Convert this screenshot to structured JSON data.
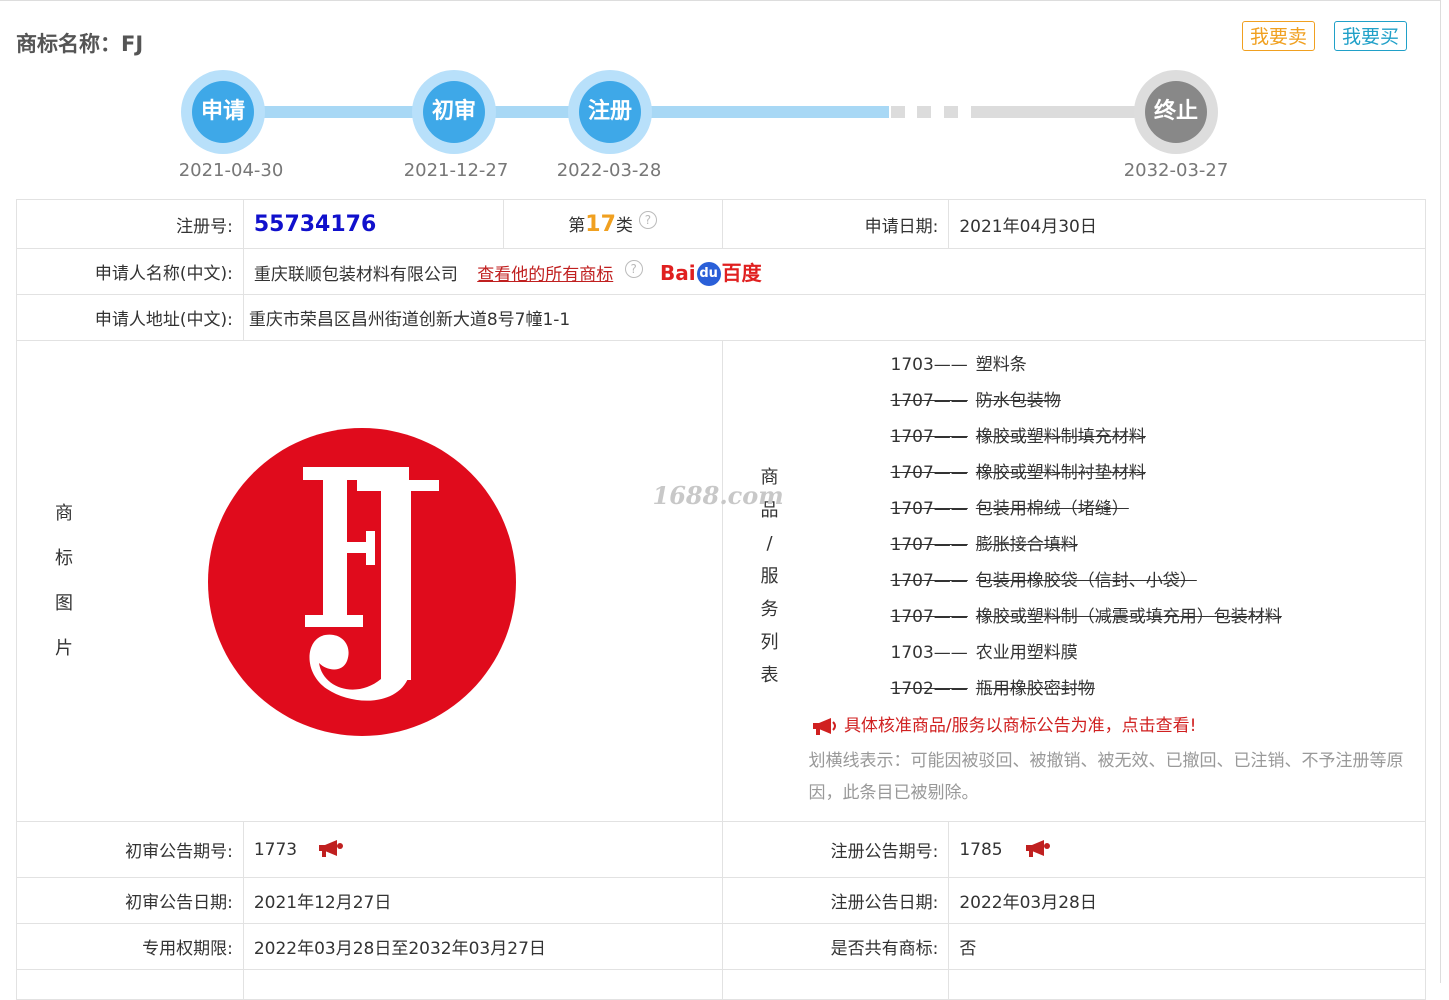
{
  "header": {
    "title": "商标名称：FJ",
    "sell_label": "我要卖",
    "buy_label": "我要买"
  },
  "timeline": {
    "steps": [
      {
        "label": "申请",
        "date": "2021-04-30"
      },
      {
        "label": "初审",
        "date": "2021-12-27"
      },
      {
        "label": "注册",
        "date": "2022-03-28"
      },
      {
        "label": "终止",
        "date": "2032-03-27"
      }
    ]
  },
  "info": {
    "reg_no_label": "注册号:",
    "reg_no": "55734176",
    "class_prefix": "第",
    "class_num": "17",
    "class_suffix": "类",
    "help_glyph": "?",
    "apply_date_label": "申请日期:",
    "apply_date": "2021年04月30日",
    "applicant_label": "申请人名称(中文):",
    "applicant": "重庆联顺包装材料有限公司",
    "all_marks_link": "查看他的所有商标",
    "baidu_left": "Bai",
    "baidu_mid": "du",
    "baidu_right": "百度",
    "address_label": "申请人地址(中文):",
    "address": "重庆市荣昌区昌州街道创新大道8号7幢1-1",
    "image_label": [
      "商",
      "标",
      "图",
      "片"
    ],
    "logo_text": "FJ",
    "goods_label": [
      "商",
      "品",
      "/",
      "服",
      "务",
      "列",
      "表"
    ],
    "watermark": "1688.com",
    "goods": [
      {
        "code": "1703——",
        "name": "塑料条",
        "struck": false
      },
      {
        "code": "1707——",
        "name": "防水包装物",
        "struck": true
      },
      {
        "code": "1707——",
        "name": "橡胶或塑料制填充材料",
        "struck": true
      },
      {
        "code": "1707——",
        "name": "橡胶或塑料制衬垫材料",
        "struck": true
      },
      {
        "code": "1707——",
        "name": "包装用棉绒（堵缝）",
        "struck": true
      },
      {
        "code": "1707——",
        "name": "膨胀接合填料",
        "struck": true
      },
      {
        "code": "1707——",
        "name": "包装用橡胶袋（信封、小袋）",
        "struck": true
      },
      {
        "code": "1707——",
        "name": "橡胶或塑料制（减震或填充用）包装材料",
        "struck": true
      },
      {
        "code": "1703——",
        "name": "农业用塑料膜",
        "struck": false
      },
      {
        "code": "1702——",
        "name": "瓶用橡胶密封物",
        "struck": true
      }
    ],
    "goods_note": "具体核准商品/服务以商标公告为准，点击查看!",
    "strike_note": "划横线表示：可能因被驳回、被撤销、被无效、已撤回、已注销、不予注册等原因，此条目已被剔除。",
    "prelim_no_label": "初审公告期号:",
    "prelim_no": "1773",
    "reg_pub_no_label": "注册公告期号:",
    "reg_pub_no": "1785",
    "prelim_date_label": "初审公告日期:",
    "prelim_date": "2021年12月27日",
    "reg_pub_date_label": "注册公告日期:",
    "reg_pub_date": "2022年03月28日",
    "term_label": "专用权期限:",
    "term": "2022年03月28日至2032年03月27日",
    "shared_label": "是否共有商标:",
    "shared": "否"
  },
  "colors": {
    "accent_blue": "#3ea8e8",
    "accent_orange": "#f0a020",
    "logo_red": "#e00b1c"
  }
}
